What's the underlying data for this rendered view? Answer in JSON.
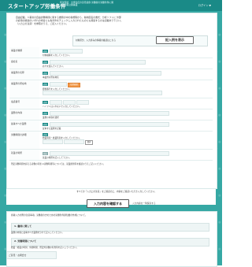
{
  "header": {
    "title": "スタートアップ労働条件",
    "subtitle": "年次有給、大学生伝の意見提供 労働者の労働条件に関する情報公開事業",
    "login": "ログイン ▼"
  },
  "intro": {
    "line1": "自由記載。人事労の自由労働時間に関する書類の中の各規程から、各制度名の書式：分析ソフトに 外部",
    "line2": "の雇用の解説のいずれの場合にも各条件をチェックし入力されたものにも関連するかは記載あり下さい。",
    "line3": "（入力上の注意）を参照のうえ、ご記入ください。",
    "red_note": "（入力上の注意）"
  },
  "saved_input": {
    "text": "対象区分、入力済みの情報の確認はこちら",
    "button": "記入例を表示"
  },
  "form": {
    "rows": [
      {
        "label": "事業の種類",
        "req": "必須",
        "text": "対象職種を入力してください。"
      },
      {
        "label": "会社名",
        "req": "必須",
        "text": "商号を選んでください。"
      },
      {
        "label": "事業所の名称",
        "req": "必須",
        "text": "事業所の所在地名"
      },
      {
        "label": "事業所の所在地",
        "req": "必須",
        "text": "郵便番号を入力してください。",
        "btn": "住所検索"
      },
      {
        "label": "電話番号",
        "req": "必須",
        "text": "ハイフンは入れないで入力してください。"
      },
      {
        "label": "業務の内容",
        "req": "必須",
        "text": "業務の内容を選択"
      },
      {
        "label": "従事すべき業務",
        "req": "必須",
        "text": "従事する業務を記載"
      },
      {
        "label": "労働時間の詳細",
        "req": "必須",
        "text": "始業時刻・終業時刻を入力してください。",
        "btn": "選択"
      },
      {
        "label": "就業の場所",
        "req": "任意",
        "text": "就業の場所を記入して下さい。"
      }
    ],
    "note": "所定労働時間を超える労働の有無 ※労働時間等については、就業規則等を確認のうえご記入ください。"
  },
  "confirm": {
    "note": "すべての「入力上の注意」をご確認の上、内容をご確認いただき入力してください。",
    "button": "入力内容を確認する",
    "back": "入力内容を一時保存する"
  },
  "bottom": {
    "intro": "各種入力の際の注意事項。労働者の方のための労働条件通知書の作成について。",
    "section1_title": "1. 雇用に関して",
    "section1_body": "業務の内容と従事すべき業務を分けて記入してください。",
    "section2_title": "2. 労働時間について",
    "section2_body": "始業・終業の時刻、休憩時間、所定外労働の有無等を記入してください。",
    "footer_tab": "ご意見・お問合せ"
  }
}
